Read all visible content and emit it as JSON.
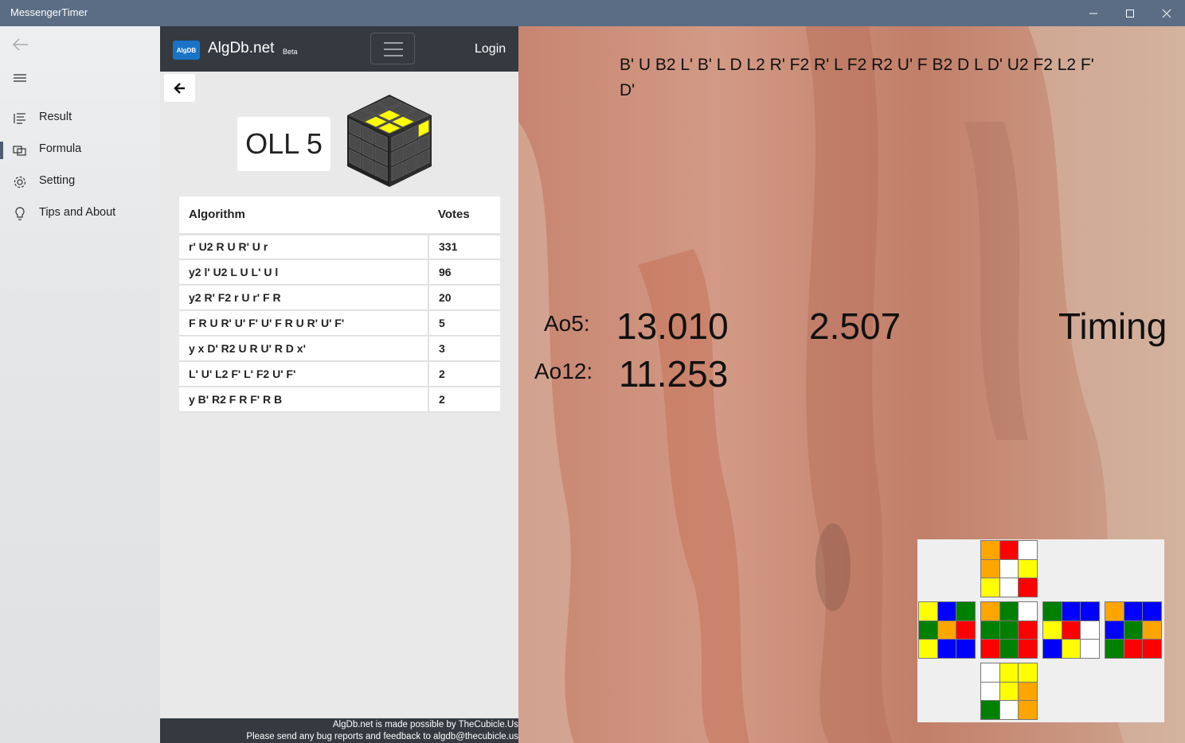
{
  "window": {
    "title": "MessengerTimer"
  },
  "sidebar": {
    "items": [
      {
        "label": "Result",
        "icon": "list-icon"
      },
      {
        "label": "Formula",
        "icon": "formula-icon"
      },
      {
        "label": "Setting",
        "icon": "gear-icon"
      },
      {
        "label": "Tips and About",
        "icon": "lightbulb-icon"
      }
    ],
    "selected_index": 1
  },
  "algdb": {
    "logo_text": "AlgDB",
    "brand": "AlgDb.net",
    "beta": "Beta",
    "login": "Login",
    "case_name": "OLL 5",
    "table": {
      "headers": [
        "Algorithm",
        "Votes"
      ],
      "rows": [
        {
          "alg": "r' U2 R U R' U r",
          "votes": "331"
        },
        {
          "alg": "y2 l' U2 L U L' U l",
          "votes": "96"
        },
        {
          "alg": "y2 R' F2 r U r' F R",
          "votes": "20"
        },
        {
          "alg": "F R U R' U' F' U' F R U R' U' F'",
          "votes": "5"
        },
        {
          "alg": "y x D' R2 U R U' R D x'",
          "votes": "3"
        },
        {
          "alg": "L' U' L2 F' L' F2 U' F'",
          "votes": "2"
        },
        {
          "alg": "y B' R2 F R F' R B",
          "votes": "2"
        }
      ]
    },
    "footer_line1": "AlgDb.net is made possible by TheCubicle.Us",
    "footer_line2": "Please send any bug reports and feedback to algdb@thecubicle.us"
  },
  "timer": {
    "scramble": "B' U B2 L' B' L D L2 R' F2 R' L F2 R2 U' F B2 D L D' U2 F2 L2 F' D'",
    "ao5_label": "Ao5:",
    "ao5_value": "13.010",
    "ao12_label": "Ao12:",
    "ao12_value": "11.253",
    "current_time": "2.507",
    "status": "Timing"
  },
  "colors": {
    "titlebar": "#5a6d85",
    "algdb_header": "#343a40",
    "W": "#ffffff",
    "Y": "#ffff00",
    "R": "#ff0000",
    "O": "#ffa500",
    "G": "#008000",
    "B": "#0000ff"
  },
  "cube_net": {
    "U": [
      "O",
      "R",
      "W",
      "O",
      "W",
      "Y",
      "Y",
      "W",
      "R"
    ],
    "L": [
      "Y",
      "B",
      "G",
      "G",
      "O",
      "R",
      "Y",
      "B",
      "B"
    ],
    "F": [
      "O",
      "G",
      "W",
      "G",
      "G",
      "R",
      "R",
      "G",
      "R"
    ],
    "R": [
      "G",
      "B",
      "B",
      "Y",
      "R",
      "W",
      "B",
      "Y",
      "W"
    ],
    "B": [
      "O",
      "B",
      "B",
      "B",
      "G",
      "O",
      "G",
      "R",
      "R"
    ],
    "D": [
      "W",
      "Y",
      "Y",
      "W",
      "Y",
      "O",
      "G",
      "W",
      "O"
    ]
  }
}
